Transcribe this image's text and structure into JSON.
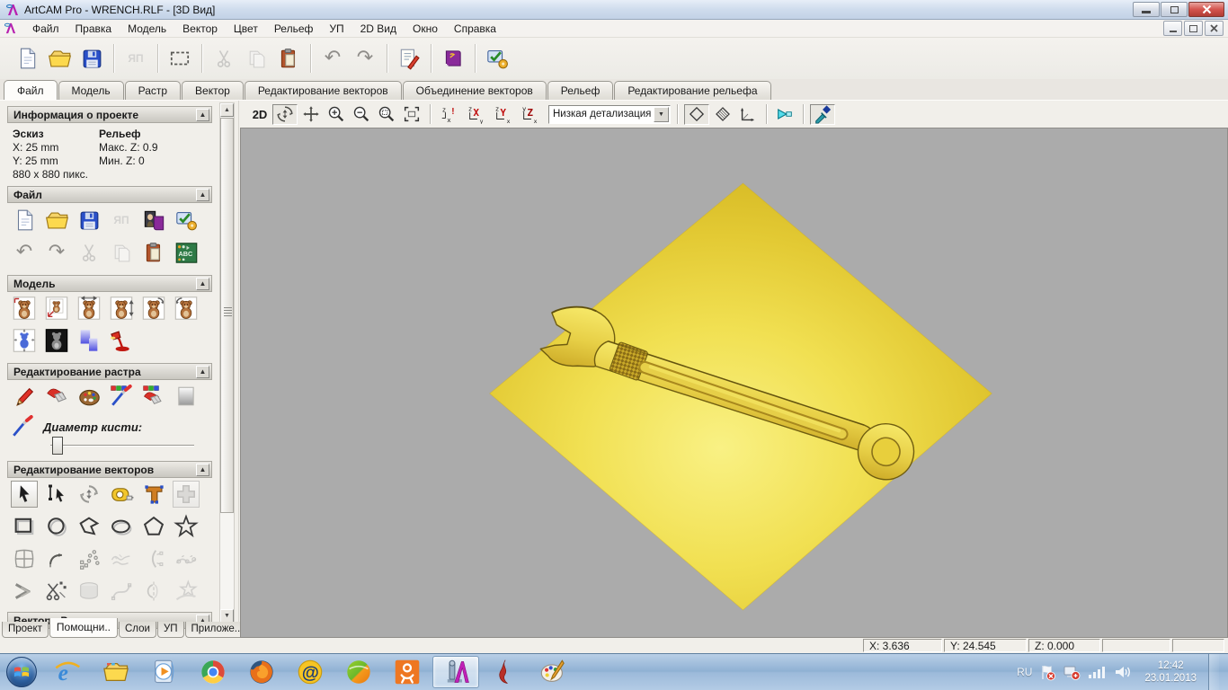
{
  "window": {
    "title": "ArtCAM Pro - WRENCH.RLF - [3D Вид]"
  },
  "menu": {
    "items": [
      "Файл",
      "Правка",
      "Модель",
      "Вектор",
      "Цвет",
      "Рельеф",
      "УП",
      "2D Вид",
      "Окно",
      "Справка"
    ]
  },
  "tabs": {
    "items": [
      "Файл",
      "Модель",
      "Растр",
      "Вектор",
      "Редактирование векторов",
      "Объединение векторов",
      "Рельеф",
      "Редактирование рельефа"
    ],
    "active": "Файл"
  },
  "panel": {
    "project_info": {
      "title": "Информация о проекте",
      "sketch_label": "Эскиз",
      "relief_label": "Рельеф",
      "x": "X: 25 mm",
      "y": "Y: 25 mm",
      "max_z": "Макс. Z: 0.9",
      "min_z": "Мин. Z: 0",
      "size": "880 x 880 пикс."
    },
    "file_section": "Файл",
    "model_section": "Модель",
    "raster_section": "Редактирование растра",
    "brush_label": "Диаметр кисти:",
    "vector_section": "Редактирование векторов",
    "vector_raster_section": "Вектор - Растр",
    "bottom_tabs": [
      "Проект",
      "Помощни..",
      "Слои",
      "УП",
      "Приложе..."
    ],
    "active_bottom_tab": "Помощни.."
  },
  "view_toolbar": {
    "mode_2d": "2D",
    "detail_level": "Низкая детализация"
  },
  "status_bar": {
    "x": "X: 3.636",
    "y": "Y: 24.545",
    "z": "Z: 0.000"
  },
  "taskbar": {
    "language": "RU",
    "time": "12:42",
    "date": "23.01.2013"
  },
  "icons": {
    "collapse": "▲",
    "scroll_up": "▲",
    "scroll_down": "▼",
    "dropdown_arrow": "▼",
    "undo": "↶",
    "redo": "↷",
    "record": "ЯП"
  },
  "colors": {
    "canvas_bg": "#ababab",
    "plane_bright": "#f8f07a",
    "plane_gold": "#ddbc28",
    "accent_blue": "#2a50c8"
  }
}
